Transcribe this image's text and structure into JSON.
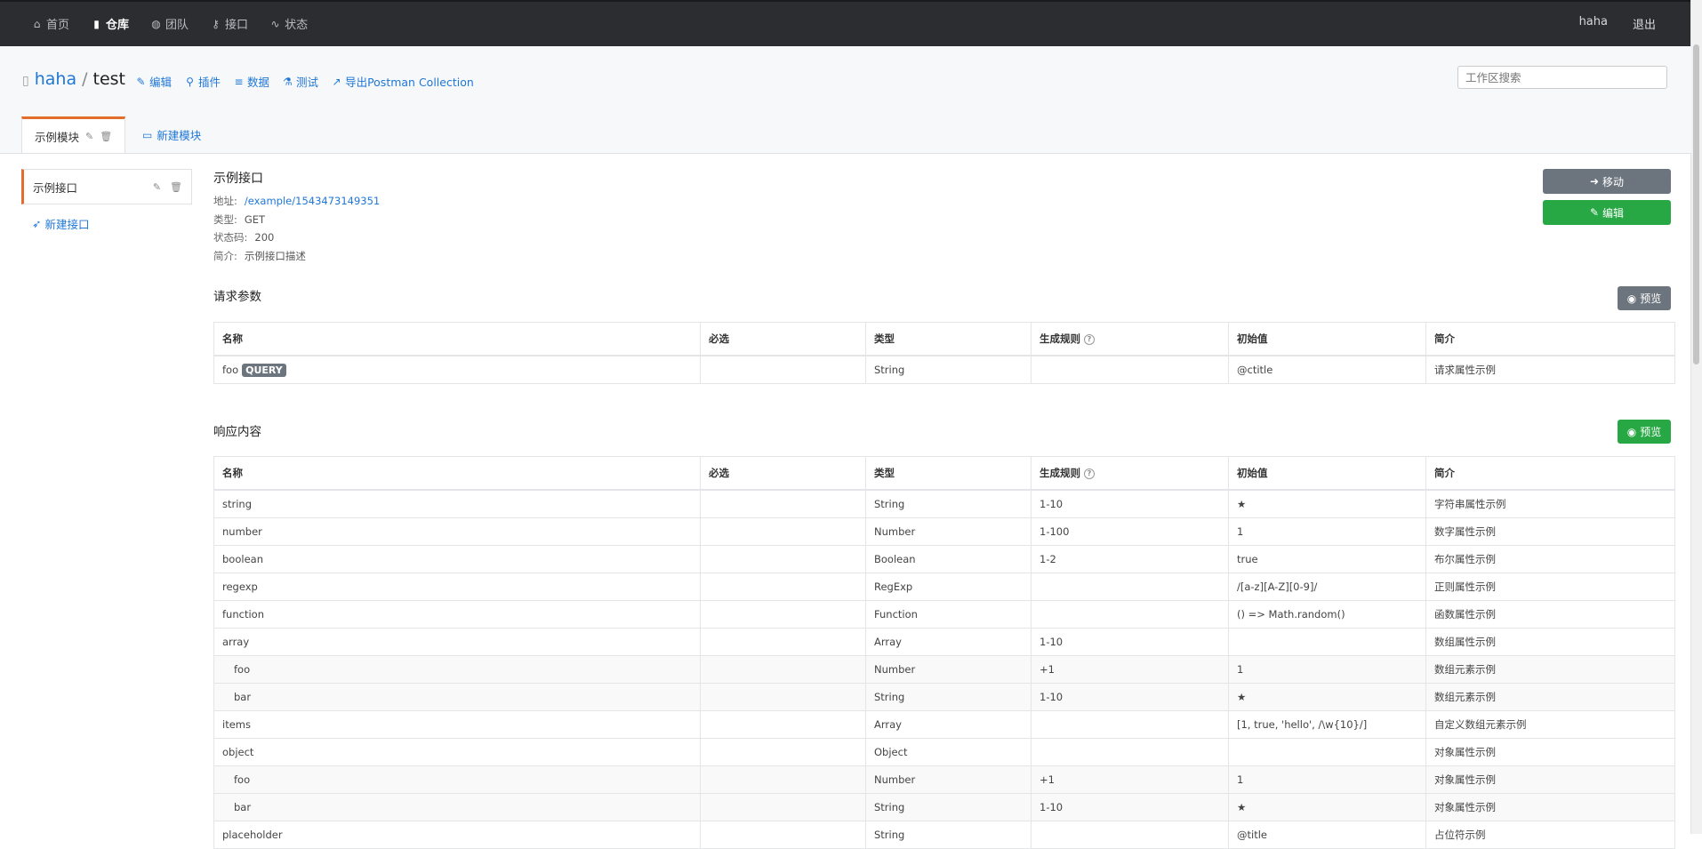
{
  "nav": {
    "items": [
      {
        "icon": "home-icon",
        "glyph": "⌂",
        "label": "首页"
      },
      {
        "icon": "book-icon",
        "glyph": "▮",
        "label": "仓库",
        "active": true
      },
      {
        "icon": "team-icon",
        "glyph": "◍",
        "label": "团队"
      },
      {
        "icon": "key-icon",
        "glyph": "⚷",
        "label": "接口"
      },
      {
        "icon": "pulse-icon",
        "glyph": "∿",
        "label": "状态"
      }
    ],
    "user": "haha",
    "logout": "退出"
  },
  "repo": {
    "owner": "haha",
    "separator": "/",
    "name": "test",
    "actions": [
      {
        "icon": "pencil-icon",
        "glyph": "✎",
        "label": "编辑"
      },
      {
        "icon": "plug-icon",
        "glyph": "⚲",
        "label": "插件"
      },
      {
        "icon": "database-icon",
        "glyph": "≡",
        "label": "数据"
      },
      {
        "icon": "flask-icon",
        "glyph": "⚗",
        "label": "测试"
      },
      {
        "icon": "external-link-icon",
        "glyph": "↗",
        "label": "导出Postman Collection"
      }
    ],
    "search_placeholder": "工作区搜索"
  },
  "modules": {
    "active": "示例模块",
    "new_label": "新建模块"
  },
  "sidebar": {
    "interface": "示例接口",
    "new_label": "新建接口"
  },
  "interface": {
    "title": "示例接口",
    "address_key": "地址:",
    "address": "/example/1543473149351",
    "type_key": "类型:",
    "type": "GET",
    "status_key": "状态码:",
    "status": "200",
    "desc_key": "简介:",
    "desc": "示例接口描述",
    "move_label": "移动",
    "edit_label": "编辑"
  },
  "request": {
    "title": "请求参数",
    "preview_label": "预览",
    "headers": [
      "名称",
      "必选",
      "类型",
      "生成规则",
      "初始值",
      "简介"
    ],
    "rows": [
      {
        "name": "foo",
        "badge": "QUERY",
        "required": "",
        "type": "String",
        "rule": "",
        "value": "@ctitle",
        "desc": "请求属性示例"
      }
    ]
  },
  "response": {
    "title": "响应内容",
    "preview_label": "预览",
    "headers": [
      "名称",
      "必选",
      "类型",
      "生成规则",
      "初始值",
      "简介"
    ],
    "rows": [
      {
        "name": "string",
        "required": "",
        "type": "String",
        "rule": "1-10",
        "value": "★",
        "desc": "字符串属性示例",
        "indent": false
      },
      {
        "name": "number",
        "required": "",
        "type": "Number",
        "rule": "1-100",
        "value": "1",
        "desc": "数字属性示例",
        "indent": false
      },
      {
        "name": "boolean",
        "required": "",
        "type": "Boolean",
        "rule": "1-2",
        "value": "true",
        "desc": "布尔属性示例",
        "indent": false
      },
      {
        "name": "regexp",
        "required": "",
        "type": "RegExp",
        "rule": "",
        "value": "/[a-z][A-Z][0-9]/",
        "desc": "正则属性示例",
        "indent": false
      },
      {
        "name": "function",
        "required": "",
        "type": "Function",
        "rule": "",
        "value": "() => Math.random()",
        "desc": "函数属性示例",
        "indent": false
      },
      {
        "name": "array",
        "required": "",
        "type": "Array",
        "rule": "1-10",
        "value": "",
        "desc": "数组属性示例",
        "indent": false
      },
      {
        "name": "foo",
        "required": "",
        "type": "Number",
        "rule": "+1",
        "value": "1",
        "desc": "数组元素示例",
        "indent": true
      },
      {
        "name": "bar",
        "required": "",
        "type": "String",
        "rule": "1-10",
        "value": "★",
        "desc": "数组元素示例",
        "indent": true
      },
      {
        "name": "items",
        "required": "",
        "type": "Array",
        "rule": "",
        "value": "[1, true, 'hello', /\\w{10}/]",
        "desc": "自定义数组元素示例",
        "indent": false
      },
      {
        "name": "object",
        "required": "",
        "type": "Object",
        "rule": "",
        "value": "",
        "desc": "对象属性示例",
        "indent": false
      },
      {
        "name": "foo",
        "required": "",
        "type": "Number",
        "rule": "+1",
        "value": "1",
        "desc": "对象属性示例",
        "indent": true
      },
      {
        "name": "bar",
        "required": "",
        "type": "String",
        "rule": "1-10",
        "value": "★",
        "desc": "对象属性示例",
        "indent": true
      },
      {
        "name": "placeholder",
        "required": "",
        "type": "String",
        "rule": "",
        "value": "@title",
        "desc": "占位符示例",
        "indent": false
      }
    ]
  }
}
